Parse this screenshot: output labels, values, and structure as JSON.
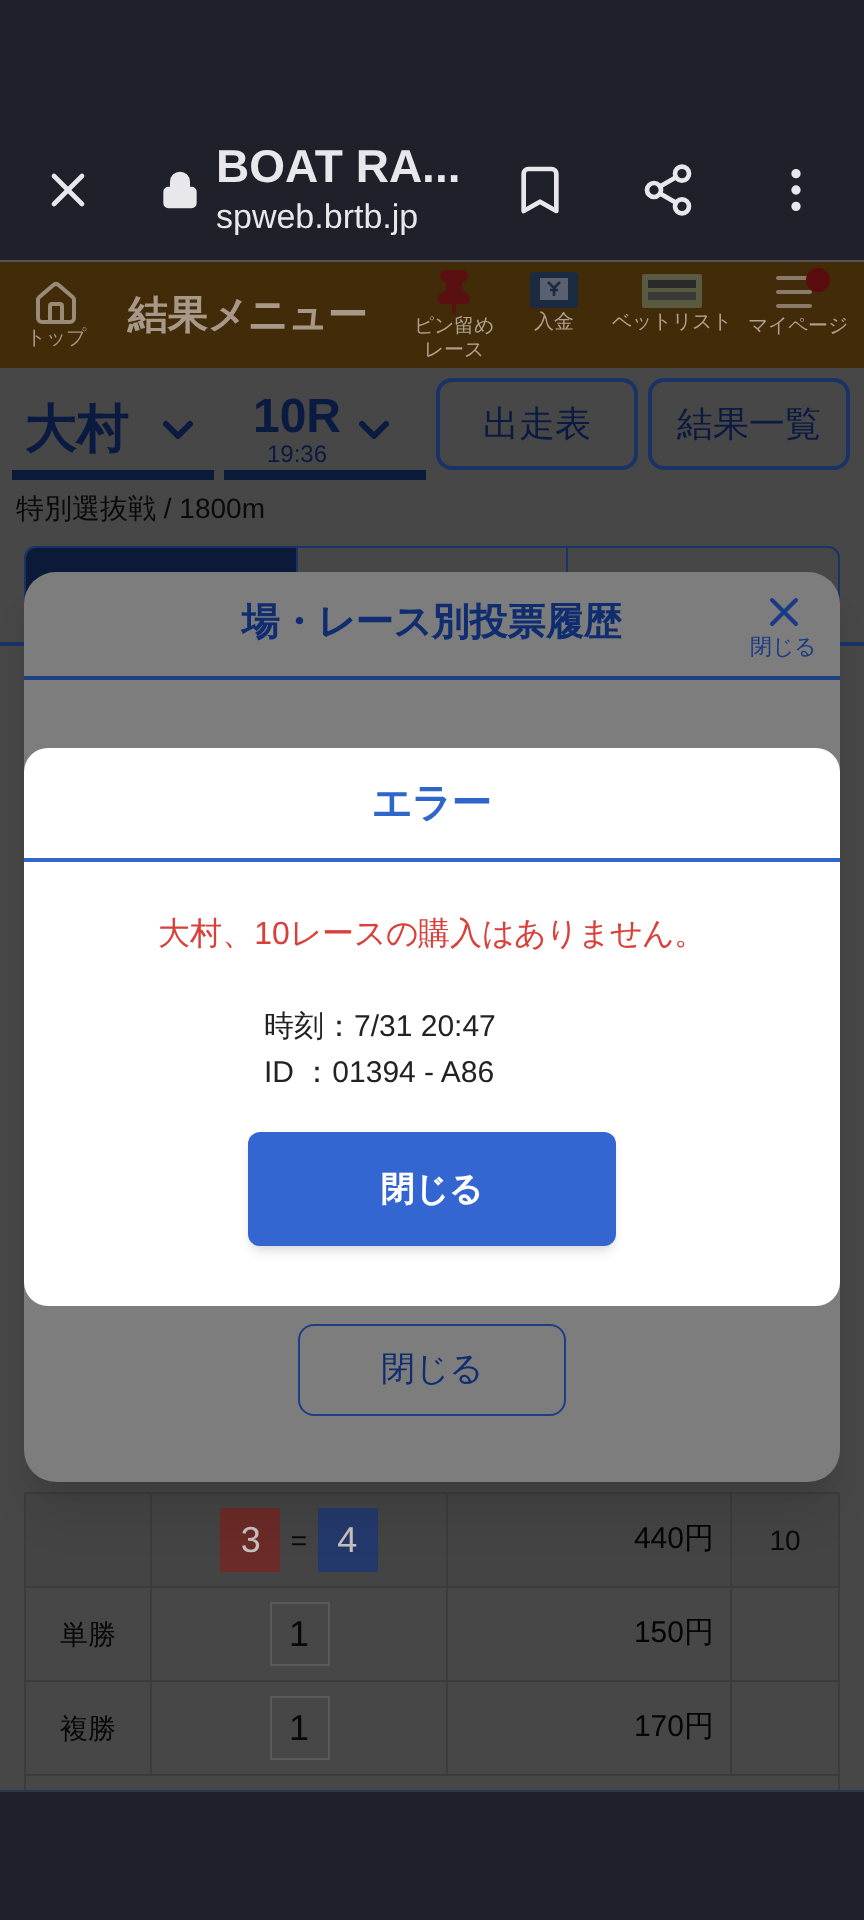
{
  "browser": {
    "title": "BOAT RA...",
    "url": "spweb.brtb.jp"
  },
  "header": {
    "home_label": "トップ",
    "title": "結果メニュー",
    "shortcuts": [
      {
        "kind": "pin",
        "label": "ピン留めレース"
      },
      {
        "kind": "deposit",
        "label": "入金"
      },
      {
        "kind": "betlist",
        "label": "ベットリスト"
      },
      {
        "kind": "mypage",
        "label": "マイページ"
      }
    ]
  },
  "selector": {
    "venue": "大村",
    "race": "10R",
    "time": "19:36",
    "buttons": [
      "出走表",
      "結果一覧"
    ]
  },
  "race_info": "特別選抜戦 / 1800m",
  "tabs": [
    {
      "selected": true
    },
    {
      "selected": false
    },
    {
      "selected": false
    }
  ],
  "history_modal": {
    "title": "場・レース別投票履歴",
    "close_label": "閉じる",
    "close_button": "閉じる"
  },
  "error_dialog": {
    "title": "エラー",
    "message": "大村、10レースの購入はありません。",
    "details": [
      "時刻：7/31 20:47",
      "ID ：01394 - A86"
    ],
    "button": "閉じる"
  },
  "payouts": [
    {
      "combination": [
        {
          "number": "3",
          "color": "#6b2b27"
        },
        {
          "number": "4",
          "color": "#24396b"
        }
      ],
      "separator": "=",
      "amount": "440円",
      "popularity": "10"
    },
    {
      "type": "単勝",
      "combination": [
        {
          "number": "1",
          "color": "#474747"
        }
      ],
      "amount": "150円"
    },
    {
      "type": "複勝",
      "combination": [
        {
          "number": "1",
          "color": "#474747"
        }
      ],
      "amount": "170円"
    }
  ]
}
